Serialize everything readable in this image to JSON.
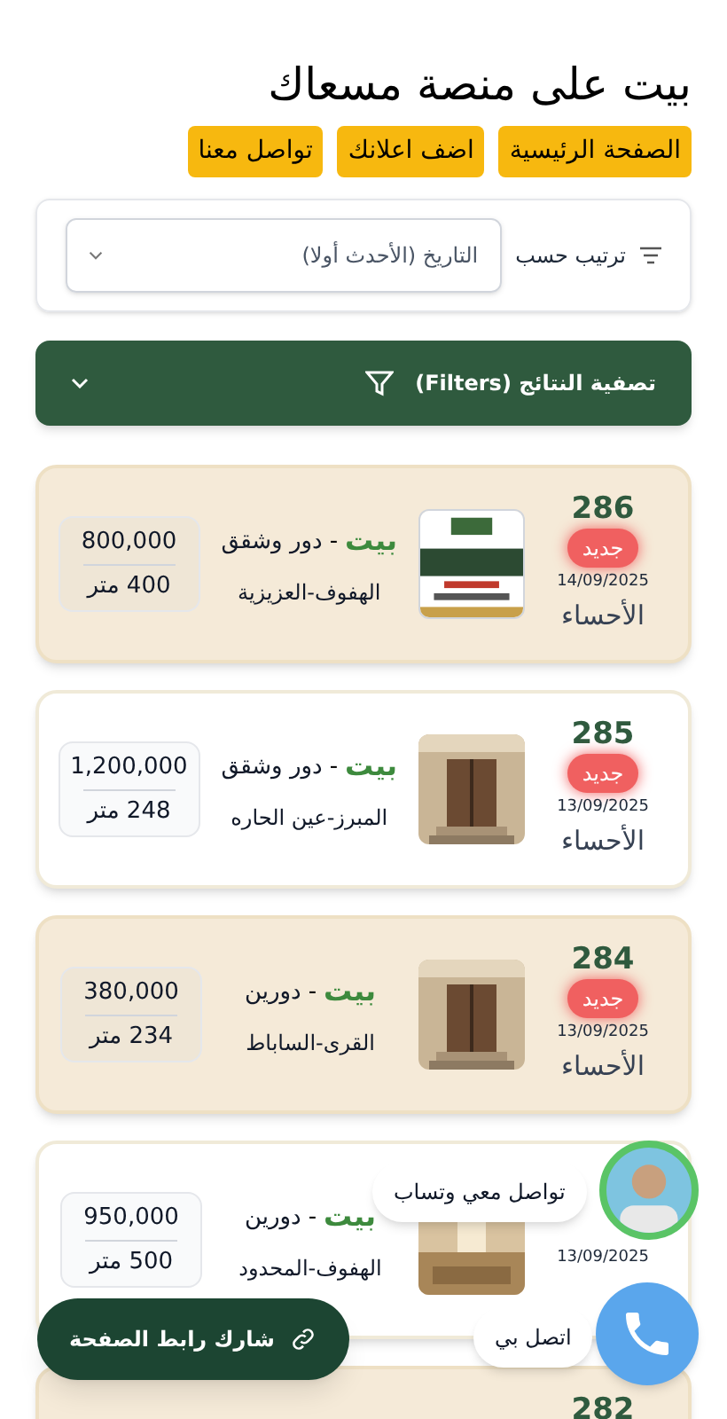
{
  "header": {
    "title": "بيت على منصة مسعاك"
  },
  "nav": [
    {
      "label": "الصفحة الرئيسية"
    },
    {
      "label": "اضف اعلانك"
    },
    {
      "label": "تواصل معنا"
    }
  ],
  "sort": {
    "label": "ترتيب حسب",
    "value": "التاريخ (الأحدث أولا)"
  },
  "filters": {
    "label": "تصفية النتائج (Filters)",
    "expanded": false
  },
  "listings": [
    {
      "number": "286",
      "badge": "جديد",
      "date": "14/09/2025",
      "city": "الأحساء",
      "type": "بيت",
      "separator": "-",
      "subtype": "دور وشقق",
      "location": "الهفوف-العزيزية",
      "price": "800,000",
      "area": "400 متر",
      "highlighted": true
    },
    {
      "number": "285",
      "badge": "جديد",
      "date": "13/09/2025",
      "city": "الأحساء",
      "type": "بيت",
      "separator": "-",
      "subtype": "دور وشقق",
      "location": "المبرز-عين الحاره",
      "price": "1,200,000",
      "area": "248 متر",
      "highlighted": false
    },
    {
      "number": "284",
      "badge": "جديد",
      "date": "13/09/2025",
      "city": "الأحساء",
      "type": "بيت",
      "separator": "-",
      "subtype": "دورين",
      "location": "القرى-الساباط",
      "price": "380,000",
      "area": "234 متر",
      "highlighted": true
    },
    {
      "date": "13/09/2025",
      "type": "بيت",
      "separator": "-",
      "subtype": "دورين",
      "location": "الهفوف-المحدود",
      "price": "950,000",
      "area": "500 متر",
      "highlighted": false
    },
    {
      "number": "282",
      "highlighted": true
    }
  ],
  "whatsapp": {
    "label": "تواصل معي وتساب"
  },
  "call": {
    "label": "اتصل بي"
  },
  "share": {
    "label": "شارك رابط الصفحة"
  }
}
